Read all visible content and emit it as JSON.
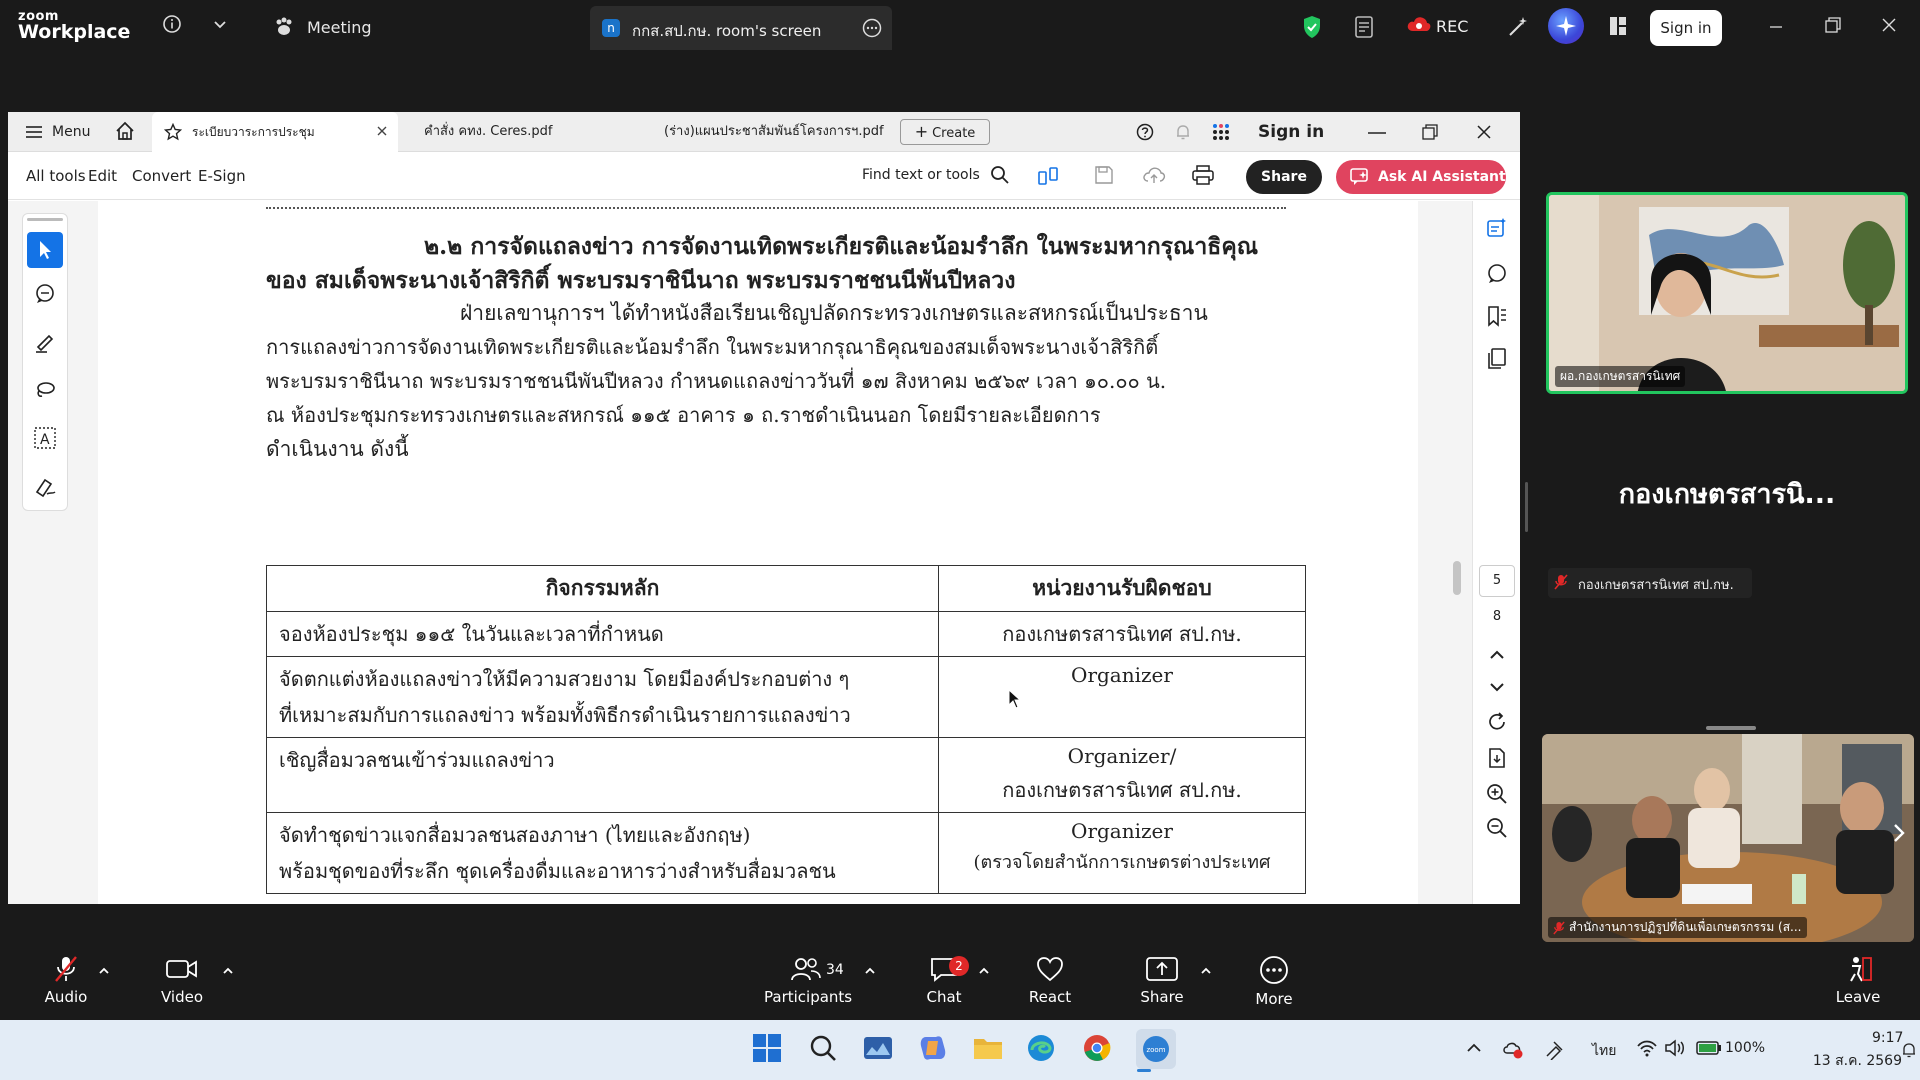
{
  "app": {
    "logo_small": "zoom",
    "logo_big": "Workplace",
    "meeting_label": "Meeting",
    "share_tab_title": "กกส.สป.กษ. room's screen",
    "share_tab_icon": "n",
    "rec_label": "REC",
    "signin": "Sign in"
  },
  "acrobat": {
    "menu_label": "Menu",
    "tabs": [
      {
        "label": "ระเบียบวาระการประชุม",
        "active": true
      },
      {
        "label": "คำสั่ง คทง. Ceres.pdf"
      },
      {
        "label": "(ร่าง)แผนประชาสัมพันธ์โครงการฯ.pdf"
      }
    ],
    "create_label": "Create",
    "signin": "Sign in",
    "toolbar": {
      "all_tools": "All tools",
      "edit": "Edit",
      "convert": "Convert",
      "esign": "E-Sign",
      "find": "Find text or tools",
      "share": "Share",
      "ask_ai": "Ask AI Assistant"
    },
    "page_current": "5",
    "page_total": "8"
  },
  "document": {
    "heading_line1": "๒.๒ การจัดแถลงข่าว การจัดงานเทิดพระเกียรติและน้อมรำลึก ในพระมหากรุณาธิคุณ",
    "heading_line2": "ของ สมเด็จพระนางเจ้าสิริกิติ์ พระบรมราชินีนาถ พระบรมราชชนนีพันปีหลวง",
    "para_lines": [
      "ฝ่ายเลขานุการฯ ได้ทำหนังสือเรียนเชิญปลัดกระทรวงเกษตรและสหกรณ์เป็นประธาน",
      "การแถลงข่าวการจัดงานเทิดพระเกียรติและน้อมรำลึก ในพระมหากรุณาธิคุณของสมเด็จพระนางเจ้าสิริกิติ์",
      "พระบรมราชินีนาถ พระบรมราชชนนีพันปีหลวง กำหนดแถลงข่าววันที่ ๑๗ สิงหาคม ๒๕๖๙  เวลา ๑๐.๐๐ น.",
      "ณ ห้องประชุมกระทรวงเกษตรและสหกรณ์ ๑๑๕ อาคาร ๑ ถ.ราชดำเนินนอก โดยมีรายละเอียดการ",
      "ดำเนินงาน ดังนี้"
    ],
    "table": {
      "headers": [
        "กิจกรรมหลัก",
        "หน่วยงานรับผิดชอบ"
      ],
      "rows": [
        {
          "activity": [
            "จองห้องประชุม ๑๑๕ ในวันและเวลาที่กำหนด"
          ],
          "owner": [
            "กองเกษตรสารนิเทศ สป.กษ."
          ]
        },
        {
          "activity": [
            "จัดตกแต่งห้องแถลงข่าวให้มีความสวยงาม โดยมีองค์ประกอบต่าง ๆ",
            "ที่เหมาะสมกับการแถลงข่าว พร้อมทั้งพิธีกรดำเนินรายการแถลงข่าว"
          ],
          "owner": [
            "Organizer"
          ]
        },
        {
          "activity": [
            "เชิญสื่อมวลชนเข้าร่วมแถลงข่าว"
          ],
          "owner": [
            "Organizer/",
            "กองเกษตรสารนิเทศ สป.กษ."
          ]
        },
        {
          "activity": [
            "จัดทำชุดข่าวแจกสื่อมวลชนสองภาษา (ไทยและอังกฤษ)",
            "พร้อมชุดของที่ระลึก ชุดเครื่องดื่มและอาหารว่างสำหรับสื่อมวลชน"
          ],
          "owner": [
            "Organizer",
            "(ตรวจโดยสำนักการเกษตรต่างประเทศ"
          ]
        }
      ]
    }
  },
  "participants_panel": {
    "video1_name": "ผอ.กองเกษตรสารนิเทศ",
    "tile2_name": "กองเกษตรสารนิ...",
    "tile2_sub": "กองเกษตรสารนิเทศ สป.กษ.",
    "video3_name": "สำนักงานการปฏิรูปที่ดินเพื่อเกษตรกรรม (ส..."
  },
  "controls": {
    "audio": "Audio",
    "video": "Video",
    "participants": "Participants",
    "participants_count": "34",
    "chat": "Chat",
    "chat_badge": "2",
    "react": "React",
    "share": "Share",
    "more": "More",
    "leave": "Leave"
  },
  "taskbar": {
    "lang": "ไทย",
    "battery": "100%",
    "time": "9:17",
    "date": "13 ส.ค. 2569"
  },
  "colors": {
    "zoom_bg": "#1a1a1a",
    "active_speaker": "#22c55e",
    "acrobat_blue": "#1473e6",
    "ask_ai_pink": "#e0445f",
    "leave_red": "#e02828"
  }
}
